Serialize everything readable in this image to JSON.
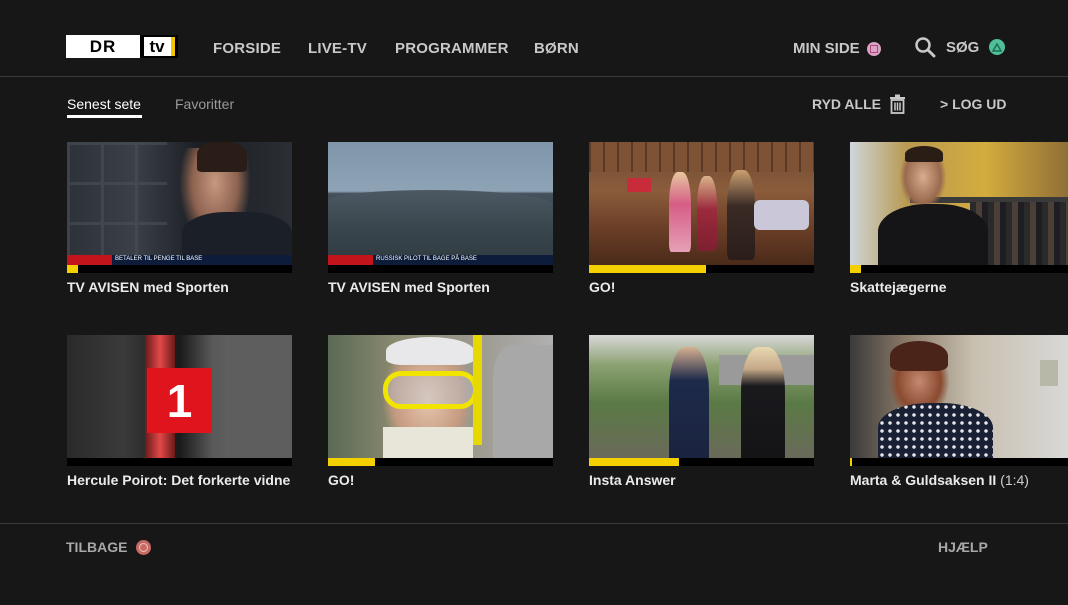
{
  "brand": {
    "logo_dr": "DR",
    "logo_tv": "tv"
  },
  "nav": [
    {
      "label": "FORSIDE"
    },
    {
      "label": "LIVE-TV"
    },
    {
      "label": "PROGRAMMER"
    },
    {
      "label": "BØRN"
    }
  ],
  "header": {
    "my_page_label": "MIN SIDE",
    "search_label": "SØG"
  },
  "tabs": [
    {
      "label": "Senest sete",
      "active": true
    },
    {
      "label": "Favoritter",
      "active": false
    }
  ],
  "actions": {
    "clear_all_label": "RYD ALLE",
    "logout_label": "> LOG UD"
  },
  "tiles": [
    {
      "title": "TV AVISEN med Sporten",
      "progress": 0.05,
      "ticker": "BETALER TIL PENGE TIL BASE"
    },
    {
      "title": "TV AVISEN med Sporten",
      "progress": 0.0,
      "ticker": "RUSSISK PILOT TIL BAGE PÅ BASE"
    },
    {
      "title": "GO!",
      "progress": 0.52
    },
    {
      "title": "Skattejægerne",
      "progress": 0.05
    },
    {
      "title": "Hercule Poirot: Det forkerte vidne",
      "progress": 0.0,
      "channel_number": "1"
    },
    {
      "title": "GO!",
      "progress": 0.21
    },
    {
      "title": "Insta Answer",
      "progress": 0.4
    },
    {
      "title": "Marta & Guldsaksen II",
      "episode": "(1:4)",
      "progress": 0.01
    }
  ],
  "footer": {
    "back_label": "TILBAGE",
    "help_label": "HJÆLP"
  },
  "colors": {
    "background": "#171717",
    "progress_fill": "#f5d000",
    "accent_yellow": "#f5c400"
  }
}
